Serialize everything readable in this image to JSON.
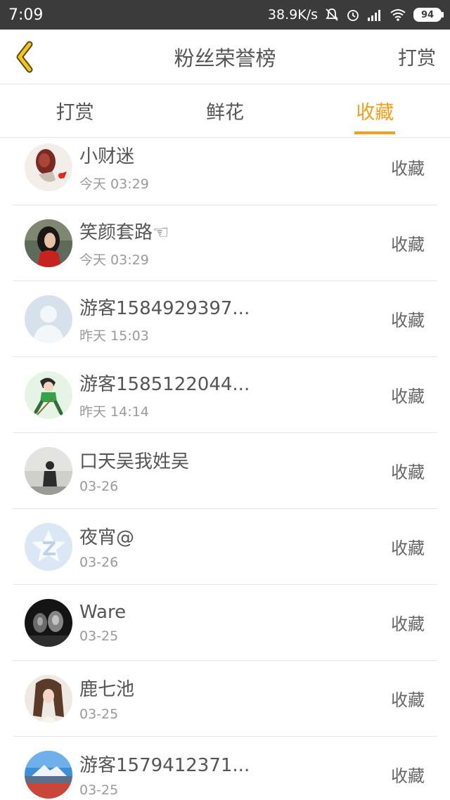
{
  "status_bar": {
    "time": "7:09",
    "speed": "38.9K/s",
    "battery": "94"
  },
  "header": {
    "title": "粉丝荣誉榜",
    "action": "打赏",
    "accent_color": "#f0a11c"
  },
  "tabs": [
    {
      "label": "打赏",
      "active": false
    },
    {
      "label": "鲜花",
      "active": false
    },
    {
      "label": "收藏",
      "active": true
    }
  ],
  "rows": [
    {
      "name": "小财迷",
      "time": "今天 03:29",
      "action": "收藏",
      "avatar": "avatar-red-flowers"
    },
    {
      "name": "笑颜套路☜",
      "time": "今天 03:29",
      "action": "收藏",
      "avatar": "avatar-woman-red"
    },
    {
      "name": "游客1584929397...",
      "time": "昨天 15:03",
      "action": "收藏",
      "avatar": "avatar-default-gray"
    },
    {
      "name": "游客1585122044...",
      "time": "昨天 14:14",
      "action": "收藏",
      "avatar": "avatar-cartoon-green"
    },
    {
      "name": "口天吴我姓吴",
      "time": "03-26",
      "action": "收藏",
      "avatar": "avatar-silhouette"
    },
    {
      "name": "夜宵@",
      "time": "03-26",
      "action": "收藏",
      "avatar": "avatar-qzone-star"
    },
    {
      "name": "Ware",
      "time": "03-25",
      "action": "收藏",
      "avatar": "avatar-dark-portrait"
    },
    {
      "name": "鹿七池",
      "time": "03-25",
      "action": "收藏",
      "avatar": "avatar-girl-hair"
    },
    {
      "name": "游客1579412371...",
      "time": "03-25",
      "action": "收藏",
      "avatar": "avatar-landscape"
    }
  ]
}
